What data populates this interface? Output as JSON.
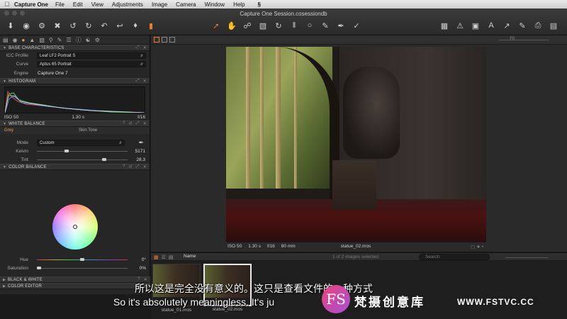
{
  "menubar": {
    "app_name": "Capture One",
    "items": [
      "File",
      "Edit",
      "View",
      "Adjustments",
      "Image",
      "Camera",
      "Window",
      "Help"
    ]
  },
  "window": {
    "title": "Capture One Session.cosessiondb"
  },
  "tool_tabs": [
    "folder-icon",
    "camera-icon",
    "color-icon",
    "exposure-icon",
    "crop-icon",
    "magnifier-icon",
    "brush-icon",
    "list-icon",
    "info-icon",
    "adjust-icon",
    "gear-icon"
  ],
  "base_characteristics": {
    "header": "BASE CHARACTERISTICS",
    "icc_label": "ICC Profile",
    "icc_value": "Leaf LF2 Portrait S",
    "curve_label": "Curve",
    "curve_value": "Aptus 65 Portrait",
    "engine_label": "Engine",
    "engine_value": "Capture One 7"
  },
  "histogram": {
    "header": "HISTOGRAM",
    "iso": "ISO 50",
    "shutter": "1.30 s",
    "aperture": "f/16"
  },
  "white_balance": {
    "header": "WHITE BALANCE",
    "tab_grey": "Grey",
    "tab_skin": "Skin Tone",
    "mode_label": "Mode",
    "mode_value": "Custom",
    "kelvin_label": "Kelvin",
    "kelvin_value": "5171",
    "kelvin_level": 0.33,
    "tint_label": "Tint",
    "tint_value": "28.3",
    "tint_level": 0.74
  },
  "color_balance": {
    "header": "COLOR BALANCE",
    "hue_label": "Hue",
    "hue_value": "0°",
    "hue_level": 0.5,
    "saturation_label": "Saturation",
    "saturation_value": "0%",
    "saturation_level": 0.02
  },
  "collapsed_sections": {
    "black_white": "BLACK & WHITE",
    "color_editor": "COLOR EDITOR"
  },
  "viewer": {
    "fit_label": "Fit",
    "meta": {
      "iso": "ISO 50",
      "shutter": "1.30 s",
      "aperture": "f/16",
      "focal": "80 mm",
      "filename": "statue_02.mos"
    }
  },
  "browser": {
    "sort_label": "Name",
    "count": "1 of 2 images selected",
    "search_placeholder": "Search",
    "thumbnails": [
      {
        "name": "statue_01.mos"
      },
      {
        "name": "statue_02.mos"
      }
    ]
  },
  "subtitles": {
    "chinese": "所以这是完全没有意义的。这只是查看文件的一种方式",
    "english": "So it's absolutely meaningless. It's ju"
  },
  "watermark": {
    "logo": "FS",
    "brand_cn": "梵摄创意库",
    "url": "WWW.FSTVC.CC"
  },
  "colors": {
    "accent": "#e67c2c",
    "panel": "#262626",
    "viewer_bg": "#2a2a2a"
  }
}
